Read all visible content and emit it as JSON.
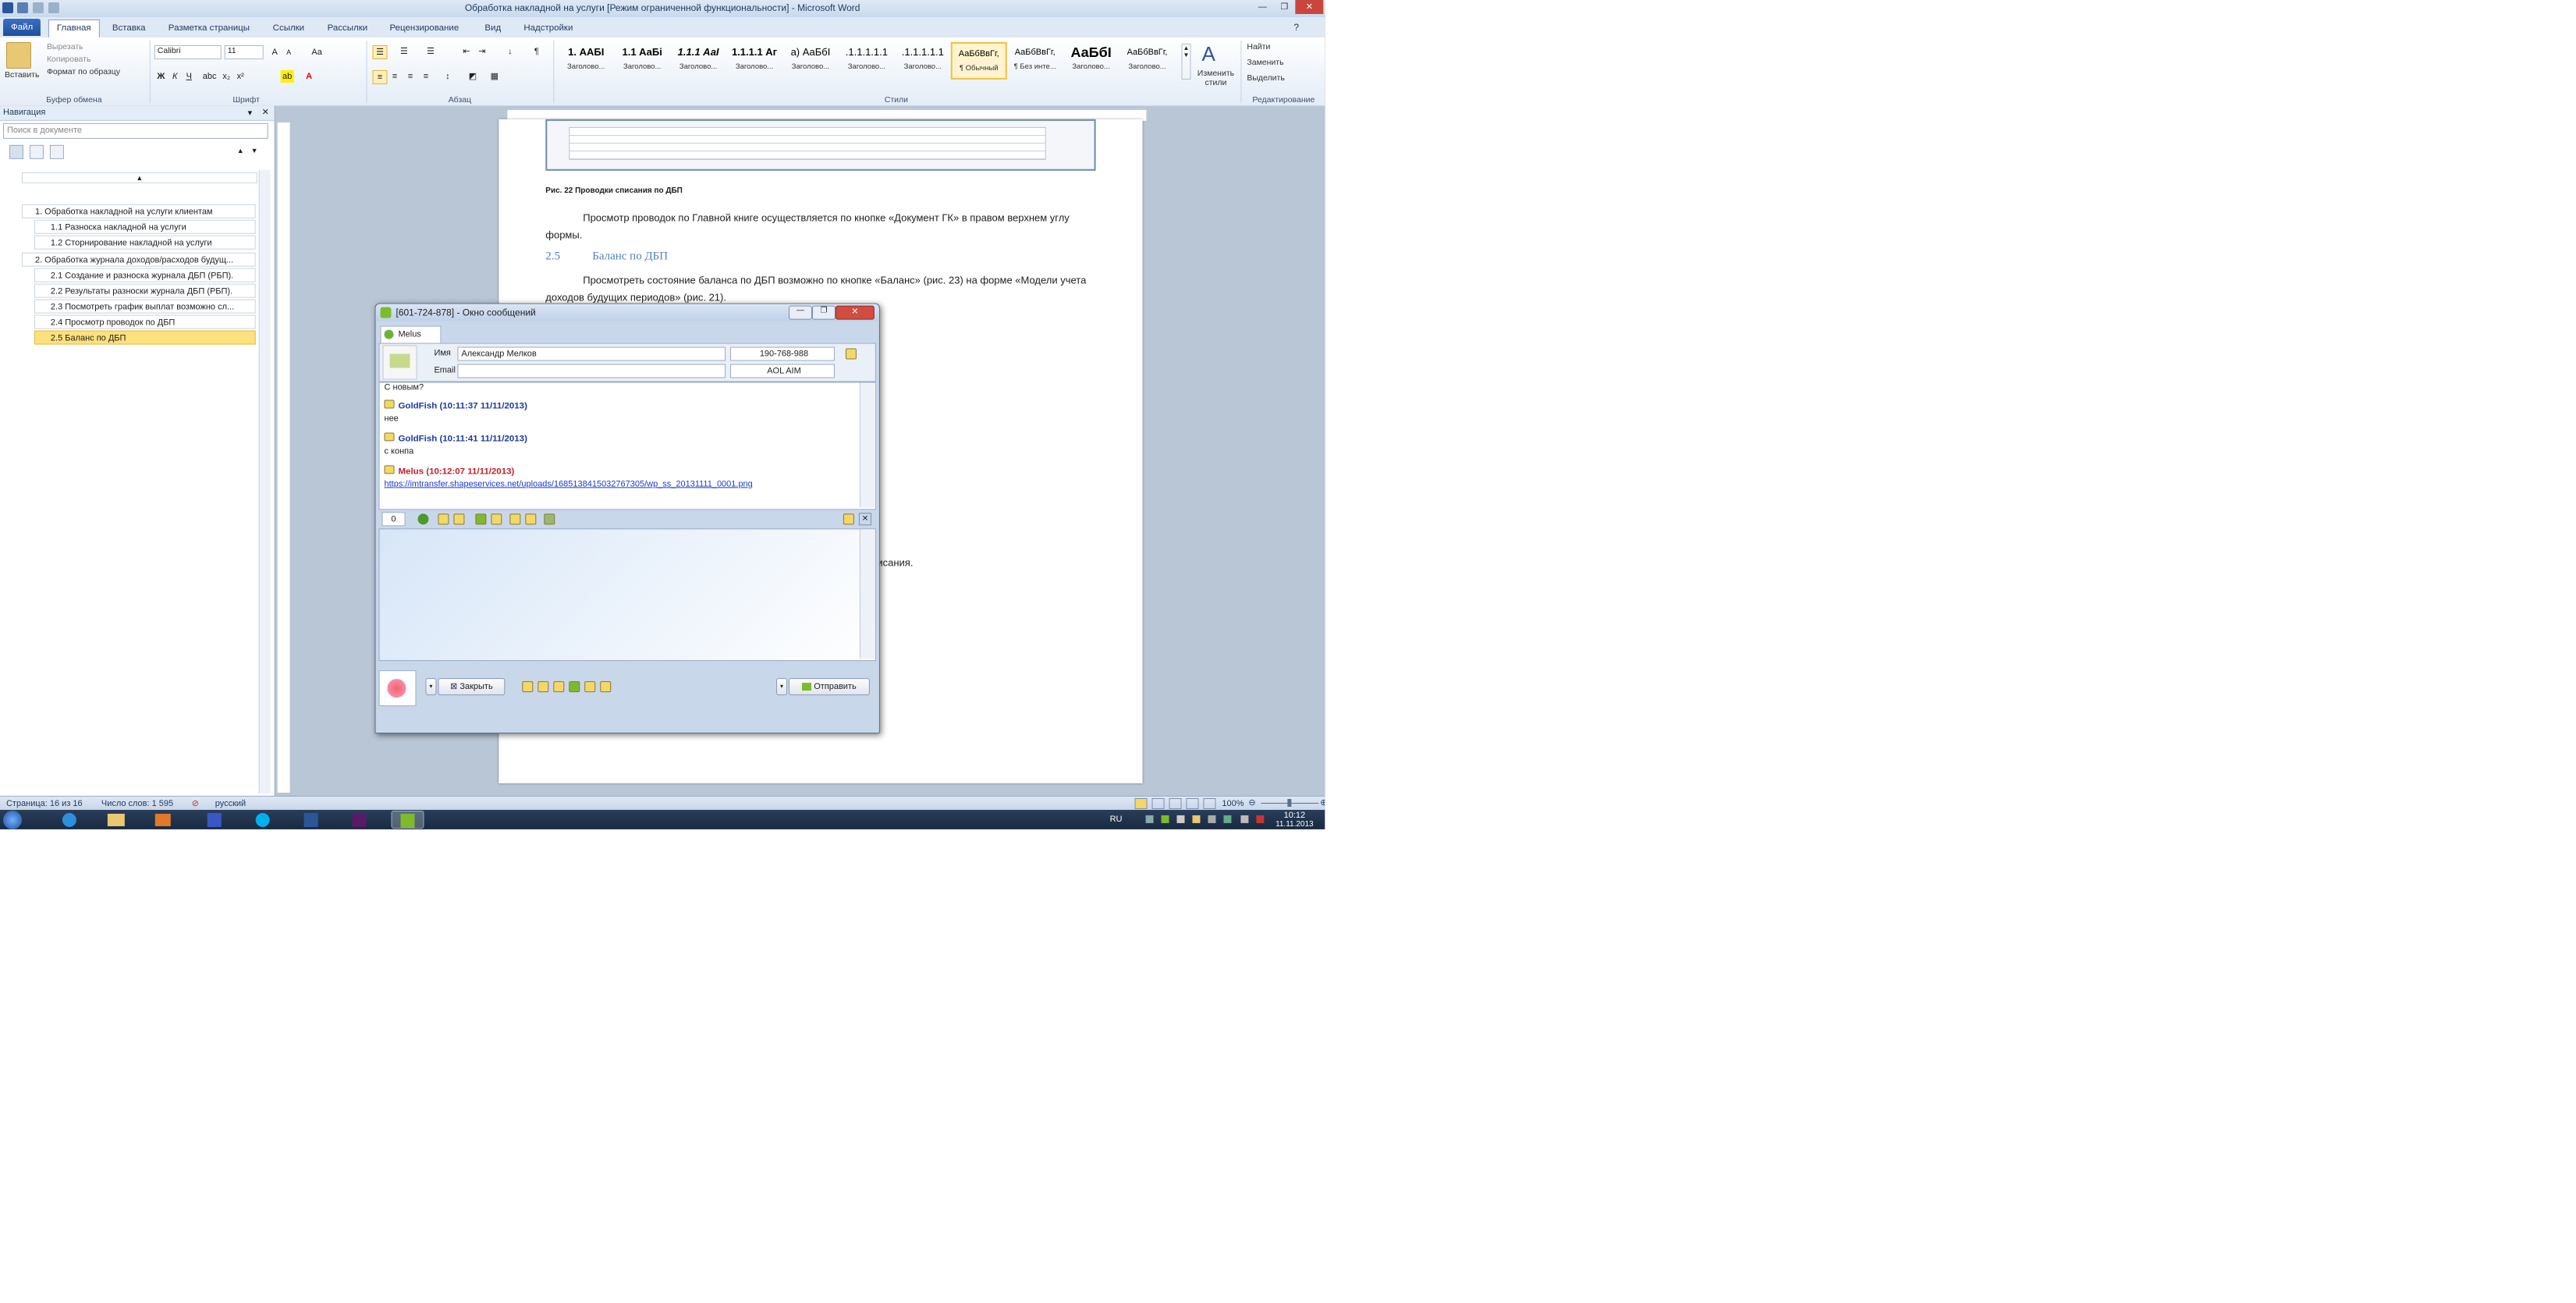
{
  "app": {
    "title": "Обработка накладной на услуги [Режим ограниченной функциональности] - Microsoft Word"
  },
  "ribbon": {
    "tabs": [
      "Файл",
      "Главная",
      "Вставка",
      "Разметка страницы",
      "Ссылки",
      "Рассылки",
      "Рецензирование",
      "Вид",
      "Надстройки"
    ],
    "clipboard": {
      "paste": "Вставить",
      "cut": "Вырезать",
      "copy": "Копировать",
      "format_painter": "Формат по образцу",
      "label": "Буфер обмена"
    },
    "font": {
      "name": "Calibri",
      "size": "11",
      "label": "Шрифт",
      "bold": "Ж",
      "italic": "К",
      "underline": "Ч"
    },
    "paragraph": {
      "label": "Абзац"
    },
    "styles": {
      "label": "Стили",
      "items": [
        {
          "preview": "1. ААБІ",
          "name": "Заголово..."
        },
        {
          "preview": "1.1 АаБі",
          "name": "Заголово..."
        },
        {
          "preview": "1.1.1 АаІ",
          "name": "Заголово..."
        },
        {
          "preview": "1.1.1.1 Аг",
          "name": "Заголово..."
        },
        {
          "preview": "а) АаБбІ",
          "name": "Заголово..."
        },
        {
          "preview": ".1.1.1.1.1",
          "name": "Заголово..."
        },
        {
          "preview": ".1.1.1.1.1",
          "name": "Заголово..."
        },
        {
          "preview": "АаБбВвГг,",
          "name": "¶ Обычный"
        },
        {
          "preview": "АаБбВвГг,",
          "name": "¶ Без инте..."
        },
        {
          "preview": "АаБбІ",
          "name": "Заголово..."
        },
        {
          "preview": "АаБбВвГг,",
          "name": "Заголово..."
        }
      ],
      "change": "Изменить стили"
    },
    "editing": {
      "find": "Найти",
      "replace": "Заменить",
      "select": "Выделить",
      "label": "Редактирование"
    }
  },
  "nav": {
    "title": "Навигация",
    "search_placeholder": "Поиск в документе",
    "items": [
      {
        "label": "1. Обработка накладной на услуги клиентам"
      },
      {
        "label": "1.1 Разноска накладной на услуги"
      },
      {
        "label": "1.2 Сторнирование накладной на услуги"
      },
      {
        "label": "2. Обработка журнала доходов/расходов будущ..."
      },
      {
        "label": "2.1 Создание и разноска журнала ДБП (РБП)."
      },
      {
        "label": "2.2 Результаты разноски журнала ДБП (РБП)."
      },
      {
        "label": "2.3 Посмотреть график выплат возможно сл..."
      },
      {
        "label": "2.4 Просмотр проводок по ДБП"
      },
      {
        "label": "2.5 Баланс по ДБП"
      }
    ]
  },
  "document": {
    "caption": "Рис. 22 Проводки списания по ДБП",
    "para1": "Просмотр проводок по Главной книге осуществляется по кнопке «Документ ГК» в правом верхнем углу формы.",
    "heading_num": "2.5",
    "heading": "Баланс по ДБП",
    "para2": "Просмотреть состояние баланса по ДБП возможно по кнопке «Баланс» (рис. 23) на форме «Модели учета доходов будущих периодов» (рис. 21).",
    "fragment": "списания."
  },
  "chat": {
    "title": "[601-724-878] - Окно сообщений",
    "tab": "Melus",
    "name_label": "Имя",
    "name_value": "Александр Мелков",
    "uin": "190-768-988",
    "email_label": "Email",
    "aol": "AOL AIM",
    "messages": [
      {
        "sender": "",
        "text": "С новым?"
      },
      {
        "sender": "GoldFish (10:11:37 11/11/2013)",
        "text": "нее"
      },
      {
        "sender": "GoldFish (10:11:41 11/11/2013)",
        "text": "с конпа"
      },
      {
        "sender": "Melus (10:12:07 11/11/2013)",
        "text": "https://imtransfer.shapeservices.net/uploads/1685138415032767305/wp_ss_20131111_0001.png"
      }
    ],
    "counter": "0",
    "close_btn": "Закрыть",
    "send_btn": "Отправить"
  },
  "status": {
    "page": "Страница: 16 из 16",
    "words": "Число слов: 1 595",
    "lang": "русский",
    "zoom": "100%"
  },
  "taskbar": {
    "lang": "RU",
    "time": "10:12",
    "date": "11.11.2013"
  }
}
